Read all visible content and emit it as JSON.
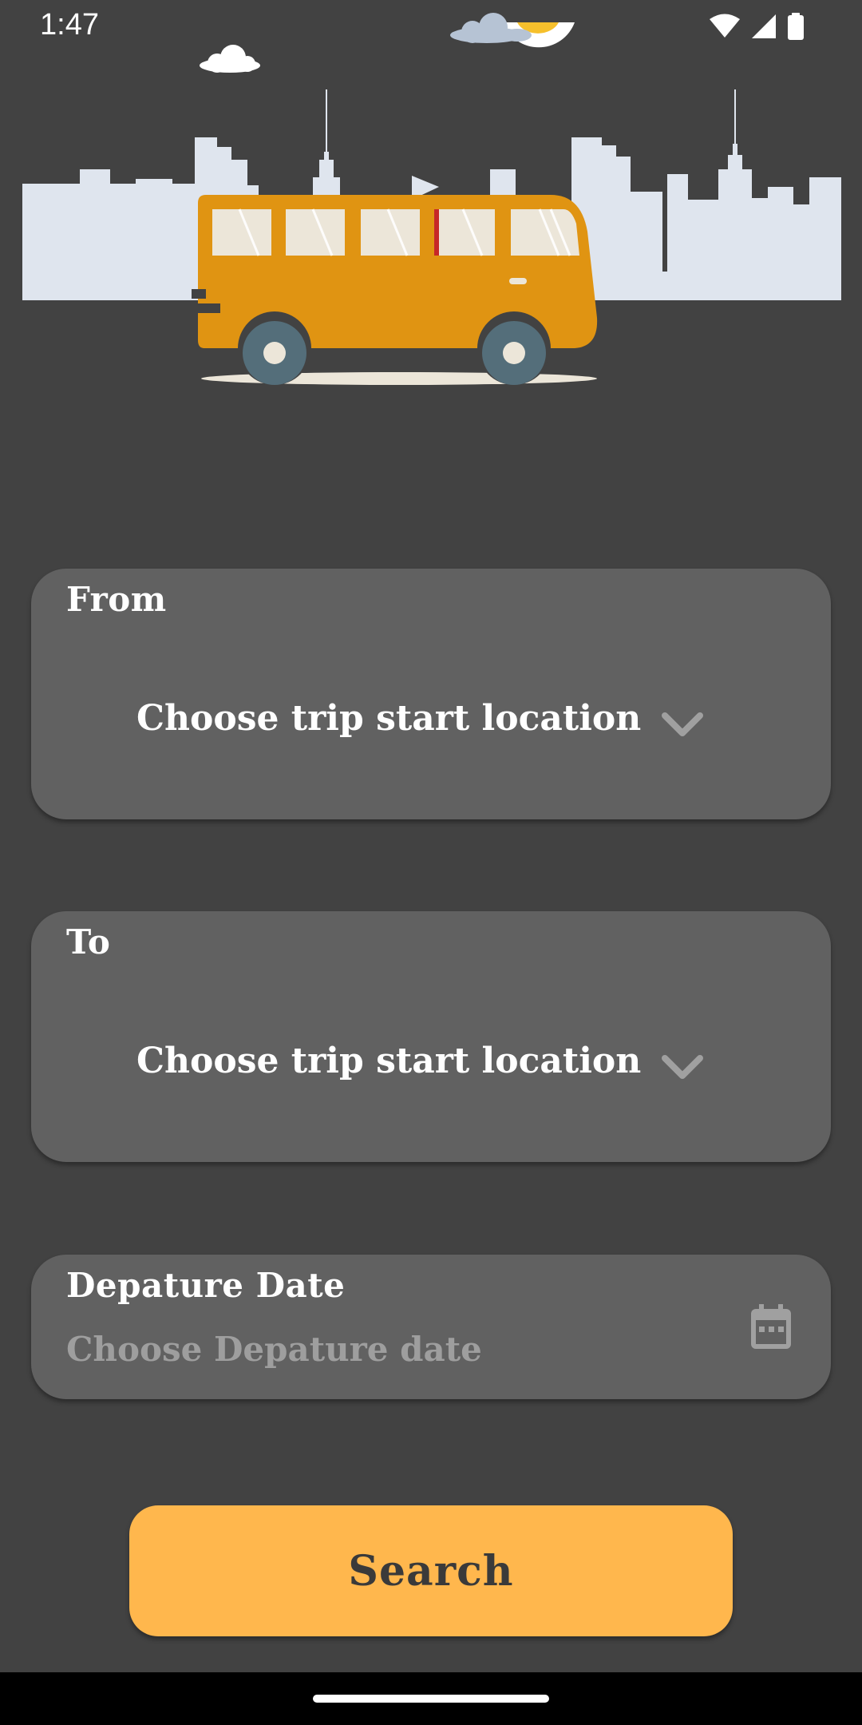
{
  "status_bar": {
    "time": "1:47",
    "icons": [
      "wifi-icon",
      "signal-icon",
      "battery-icon"
    ]
  },
  "hero": {
    "illustration": "bus-city-skyline",
    "colors": {
      "bus": "#e09412",
      "skyline": "#dfe5ee",
      "wheel": "#546e7a"
    }
  },
  "from_field": {
    "label": "From",
    "value": "Choose trip start location",
    "icon": "chevron-down-icon"
  },
  "to_field": {
    "label": "To",
    "value": "Choose trip start location",
    "icon": "chevron-down-icon"
  },
  "date_field": {
    "label": "Depature Date",
    "placeholder": "Choose Depature date",
    "icon": "calendar-icon"
  },
  "search_button": {
    "label": "Search"
  },
  "theme": {
    "background": "#424242",
    "card": "#616161",
    "accent": "#ffb74d"
  }
}
